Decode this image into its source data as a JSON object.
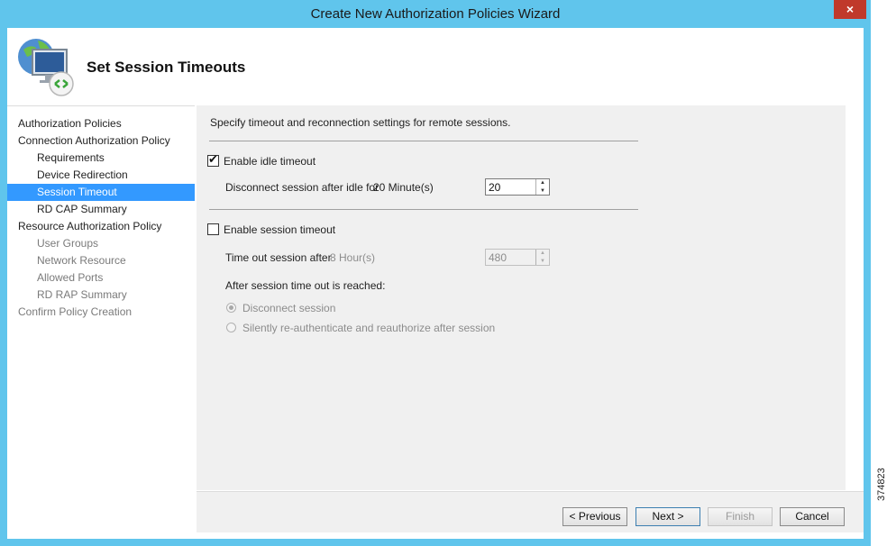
{
  "window": {
    "title": "Create New Authorization Policies Wizard",
    "close_glyph": "×",
    "accent_color": "#60c5ec"
  },
  "header": {
    "title": "Set Session Timeouts",
    "icon": "remote-desktop-computer-icon"
  },
  "nav": {
    "items": [
      {
        "label": "Authorization Policies",
        "level": 1,
        "state": "normal"
      },
      {
        "label": "Connection Authorization Policy",
        "level": 1,
        "state": "normal"
      },
      {
        "label": "Requirements",
        "level": 2,
        "state": "normal"
      },
      {
        "label": "Device Redirection",
        "level": 2,
        "state": "normal"
      },
      {
        "label": "Session Timeout",
        "level": 2,
        "state": "selected"
      },
      {
        "label": "RD CAP Summary",
        "level": 2,
        "state": "normal"
      },
      {
        "label": "Resource Authorization Policy",
        "level": 1,
        "state": "normal"
      },
      {
        "label": "User Groups",
        "level": 2,
        "state": "disabled"
      },
      {
        "label": "Network Resource",
        "level": 2,
        "state": "disabled"
      },
      {
        "label": "Allowed Ports",
        "level": 2,
        "state": "disabled"
      },
      {
        "label": "RD RAP Summary",
        "level": 2,
        "state": "disabled"
      },
      {
        "label": "Confirm Policy Creation",
        "level": 1,
        "state": "disabled"
      }
    ]
  },
  "content": {
    "intro": "Specify timeout and reconnection settings for remote sessions.",
    "idle": {
      "checkbox_label": "Enable idle timeout",
      "checked": true,
      "check_glyph": "✔",
      "field_label": "Disconnect session after idle for",
      "field_readout": "20 Minute(s)",
      "field_value": "20"
    },
    "session": {
      "checkbox_label": "Enable session timeout",
      "checked": false,
      "field_label": "Time out session after",
      "field_readout": "8 Hour(s)",
      "field_value": "480",
      "after_label": "After session time out is reached:",
      "options": [
        {
          "label": "Disconnect session",
          "selected": true
        },
        {
          "label": "Silently re-authenticate and reauthorize after session",
          "selected": false
        }
      ]
    },
    "spin_up_glyph": "▲",
    "spin_down_glyph": "▼"
  },
  "footer": {
    "previous_label": "< Previous",
    "next_label": "Next >",
    "finish_label": "Finish",
    "cancel_label": "Cancel"
  },
  "side_id": "374823"
}
